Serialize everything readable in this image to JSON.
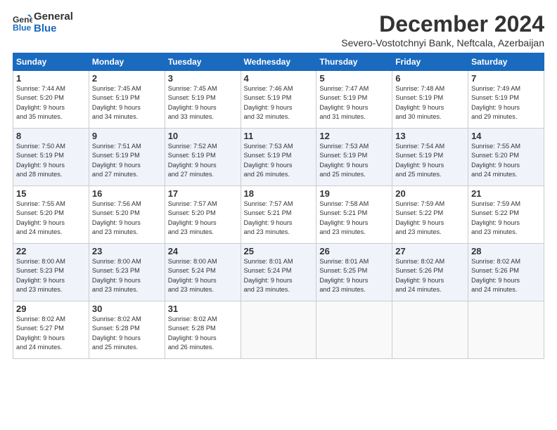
{
  "logo": {
    "line1": "General",
    "line2": "Blue"
  },
  "header": {
    "month_year": "December 2024",
    "location": "Severo-Vostotchnyi Bank, Neftcala, Azerbaijan"
  },
  "weekdays": [
    "Sunday",
    "Monday",
    "Tuesday",
    "Wednesday",
    "Thursday",
    "Friday",
    "Saturday"
  ],
  "weeks": [
    [
      {
        "day": "1",
        "info": "Sunrise: 7:44 AM\nSunset: 5:20 PM\nDaylight: 9 hours\nand 35 minutes."
      },
      {
        "day": "2",
        "info": "Sunrise: 7:45 AM\nSunset: 5:19 PM\nDaylight: 9 hours\nand 34 minutes."
      },
      {
        "day": "3",
        "info": "Sunrise: 7:45 AM\nSunset: 5:19 PM\nDaylight: 9 hours\nand 33 minutes."
      },
      {
        "day": "4",
        "info": "Sunrise: 7:46 AM\nSunset: 5:19 PM\nDaylight: 9 hours\nand 32 minutes."
      },
      {
        "day": "5",
        "info": "Sunrise: 7:47 AM\nSunset: 5:19 PM\nDaylight: 9 hours\nand 31 minutes."
      },
      {
        "day": "6",
        "info": "Sunrise: 7:48 AM\nSunset: 5:19 PM\nDaylight: 9 hours\nand 30 minutes."
      },
      {
        "day": "7",
        "info": "Sunrise: 7:49 AM\nSunset: 5:19 PM\nDaylight: 9 hours\nand 29 minutes."
      }
    ],
    [
      {
        "day": "8",
        "info": "Sunrise: 7:50 AM\nSunset: 5:19 PM\nDaylight: 9 hours\nand 28 minutes."
      },
      {
        "day": "9",
        "info": "Sunrise: 7:51 AM\nSunset: 5:19 PM\nDaylight: 9 hours\nand 27 minutes."
      },
      {
        "day": "10",
        "info": "Sunrise: 7:52 AM\nSunset: 5:19 PM\nDaylight: 9 hours\nand 27 minutes."
      },
      {
        "day": "11",
        "info": "Sunrise: 7:53 AM\nSunset: 5:19 PM\nDaylight: 9 hours\nand 26 minutes."
      },
      {
        "day": "12",
        "info": "Sunrise: 7:53 AM\nSunset: 5:19 PM\nDaylight: 9 hours\nand 25 minutes."
      },
      {
        "day": "13",
        "info": "Sunrise: 7:54 AM\nSunset: 5:19 PM\nDaylight: 9 hours\nand 25 minutes."
      },
      {
        "day": "14",
        "info": "Sunrise: 7:55 AM\nSunset: 5:20 PM\nDaylight: 9 hours\nand 24 minutes."
      }
    ],
    [
      {
        "day": "15",
        "info": "Sunrise: 7:55 AM\nSunset: 5:20 PM\nDaylight: 9 hours\nand 24 minutes."
      },
      {
        "day": "16",
        "info": "Sunrise: 7:56 AM\nSunset: 5:20 PM\nDaylight: 9 hours\nand 23 minutes."
      },
      {
        "day": "17",
        "info": "Sunrise: 7:57 AM\nSunset: 5:20 PM\nDaylight: 9 hours\nand 23 minutes."
      },
      {
        "day": "18",
        "info": "Sunrise: 7:57 AM\nSunset: 5:21 PM\nDaylight: 9 hours\nand 23 minutes."
      },
      {
        "day": "19",
        "info": "Sunrise: 7:58 AM\nSunset: 5:21 PM\nDaylight: 9 hours\nand 23 minutes."
      },
      {
        "day": "20",
        "info": "Sunrise: 7:59 AM\nSunset: 5:22 PM\nDaylight: 9 hours\nand 23 minutes."
      },
      {
        "day": "21",
        "info": "Sunrise: 7:59 AM\nSunset: 5:22 PM\nDaylight: 9 hours\nand 23 minutes."
      }
    ],
    [
      {
        "day": "22",
        "info": "Sunrise: 8:00 AM\nSunset: 5:23 PM\nDaylight: 9 hours\nand 23 minutes."
      },
      {
        "day": "23",
        "info": "Sunrise: 8:00 AM\nSunset: 5:23 PM\nDaylight: 9 hours\nand 23 minutes."
      },
      {
        "day": "24",
        "info": "Sunrise: 8:00 AM\nSunset: 5:24 PM\nDaylight: 9 hours\nand 23 minutes."
      },
      {
        "day": "25",
        "info": "Sunrise: 8:01 AM\nSunset: 5:24 PM\nDaylight: 9 hours\nand 23 minutes."
      },
      {
        "day": "26",
        "info": "Sunrise: 8:01 AM\nSunset: 5:25 PM\nDaylight: 9 hours\nand 23 minutes."
      },
      {
        "day": "27",
        "info": "Sunrise: 8:02 AM\nSunset: 5:26 PM\nDaylight: 9 hours\nand 24 minutes."
      },
      {
        "day": "28",
        "info": "Sunrise: 8:02 AM\nSunset: 5:26 PM\nDaylight: 9 hours\nand 24 minutes."
      }
    ],
    [
      {
        "day": "29",
        "info": "Sunrise: 8:02 AM\nSunset: 5:27 PM\nDaylight: 9 hours\nand 24 minutes."
      },
      {
        "day": "30",
        "info": "Sunrise: 8:02 AM\nSunset: 5:28 PM\nDaylight: 9 hours\nand 25 minutes."
      },
      {
        "day": "31",
        "info": "Sunrise: 8:02 AM\nSunset: 5:28 PM\nDaylight: 9 hours\nand 26 minutes."
      },
      {
        "day": "",
        "info": ""
      },
      {
        "day": "",
        "info": ""
      },
      {
        "day": "",
        "info": ""
      },
      {
        "day": "",
        "info": ""
      }
    ]
  ]
}
